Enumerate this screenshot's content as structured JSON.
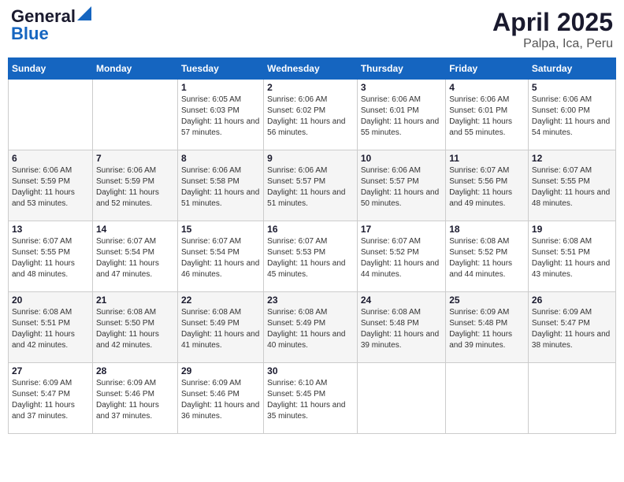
{
  "header": {
    "logo_general": "General",
    "logo_blue": "Blue",
    "title": "April 2025",
    "subtitle": "Palpa, Ica, Peru"
  },
  "calendar": {
    "weekdays": [
      "Sunday",
      "Monday",
      "Tuesday",
      "Wednesday",
      "Thursday",
      "Friday",
      "Saturday"
    ],
    "weeks": [
      [
        {
          "day": "",
          "info": ""
        },
        {
          "day": "",
          "info": ""
        },
        {
          "day": "1",
          "info": "Sunrise: 6:05 AM\nSunset: 6:03 PM\nDaylight: 11 hours and 57 minutes."
        },
        {
          "day": "2",
          "info": "Sunrise: 6:06 AM\nSunset: 6:02 PM\nDaylight: 11 hours and 56 minutes."
        },
        {
          "day": "3",
          "info": "Sunrise: 6:06 AM\nSunset: 6:01 PM\nDaylight: 11 hours and 55 minutes."
        },
        {
          "day": "4",
          "info": "Sunrise: 6:06 AM\nSunset: 6:01 PM\nDaylight: 11 hours and 55 minutes."
        },
        {
          "day": "5",
          "info": "Sunrise: 6:06 AM\nSunset: 6:00 PM\nDaylight: 11 hours and 54 minutes."
        }
      ],
      [
        {
          "day": "6",
          "info": "Sunrise: 6:06 AM\nSunset: 5:59 PM\nDaylight: 11 hours and 53 minutes."
        },
        {
          "day": "7",
          "info": "Sunrise: 6:06 AM\nSunset: 5:59 PM\nDaylight: 11 hours and 52 minutes."
        },
        {
          "day": "8",
          "info": "Sunrise: 6:06 AM\nSunset: 5:58 PM\nDaylight: 11 hours and 51 minutes."
        },
        {
          "day": "9",
          "info": "Sunrise: 6:06 AM\nSunset: 5:57 PM\nDaylight: 11 hours and 51 minutes."
        },
        {
          "day": "10",
          "info": "Sunrise: 6:06 AM\nSunset: 5:57 PM\nDaylight: 11 hours and 50 minutes."
        },
        {
          "day": "11",
          "info": "Sunrise: 6:07 AM\nSunset: 5:56 PM\nDaylight: 11 hours and 49 minutes."
        },
        {
          "day": "12",
          "info": "Sunrise: 6:07 AM\nSunset: 5:55 PM\nDaylight: 11 hours and 48 minutes."
        }
      ],
      [
        {
          "day": "13",
          "info": "Sunrise: 6:07 AM\nSunset: 5:55 PM\nDaylight: 11 hours and 48 minutes."
        },
        {
          "day": "14",
          "info": "Sunrise: 6:07 AM\nSunset: 5:54 PM\nDaylight: 11 hours and 47 minutes."
        },
        {
          "day": "15",
          "info": "Sunrise: 6:07 AM\nSunset: 5:54 PM\nDaylight: 11 hours and 46 minutes."
        },
        {
          "day": "16",
          "info": "Sunrise: 6:07 AM\nSunset: 5:53 PM\nDaylight: 11 hours and 45 minutes."
        },
        {
          "day": "17",
          "info": "Sunrise: 6:07 AM\nSunset: 5:52 PM\nDaylight: 11 hours and 44 minutes."
        },
        {
          "day": "18",
          "info": "Sunrise: 6:08 AM\nSunset: 5:52 PM\nDaylight: 11 hours and 44 minutes."
        },
        {
          "day": "19",
          "info": "Sunrise: 6:08 AM\nSunset: 5:51 PM\nDaylight: 11 hours and 43 minutes."
        }
      ],
      [
        {
          "day": "20",
          "info": "Sunrise: 6:08 AM\nSunset: 5:51 PM\nDaylight: 11 hours and 42 minutes."
        },
        {
          "day": "21",
          "info": "Sunrise: 6:08 AM\nSunset: 5:50 PM\nDaylight: 11 hours and 42 minutes."
        },
        {
          "day": "22",
          "info": "Sunrise: 6:08 AM\nSunset: 5:49 PM\nDaylight: 11 hours and 41 minutes."
        },
        {
          "day": "23",
          "info": "Sunrise: 6:08 AM\nSunset: 5:49 PM\nDaylight: 11 hours and 40 minutes."
        },
        {
          "day": "24",
          "info": "Sunrise: 6:08 AM\nSunset: 5:48 PM\nDaylight: 11 hours and 39 minutes."
        },
        {
          "day": "25",
          "info": "Sunrise: 6:09 AM\nSunset: 5:48 PM\nDaylight: 11 hours and 39 minutes."
        },
        {
          "day": "26",
          "info": "Sunrise: 6:09 AM\nSunset: 5:47 PM\nDaylight: 11 hours and 38 minutes."
        }
      ],
      [
        {
          "day": "27",
          "info": "Sunrise: 6:09 AM\nSunset: 5:47 PM\nDaylight: 11 hours and 37 minutes."
        },
        {
          "day": "28",
          "info": "Sunrise: 6:09 AM\nSunset: 5:46 PM\nDaylight: 11 hours and 37 minutes."
        },
        {
          "day": "29",
          "info": "Sunrise: 6:09 AM\nSunset: 5:46 PM\nDaylight: 11 hours and 36 minutes."
        },
        {
          "day": "30",
          "info": "Sunrise: 6:10 AM\nSunset: 5:45 PM\nDaylight: 11 hours and 35 minutes."
        },
        {
          "day": "",
          "info": ""
        },
        {
          "day": "",
          "info": ""
        },
        {
          "day": "",
          "info": ""
        }
      ]
    ]
  }
}
